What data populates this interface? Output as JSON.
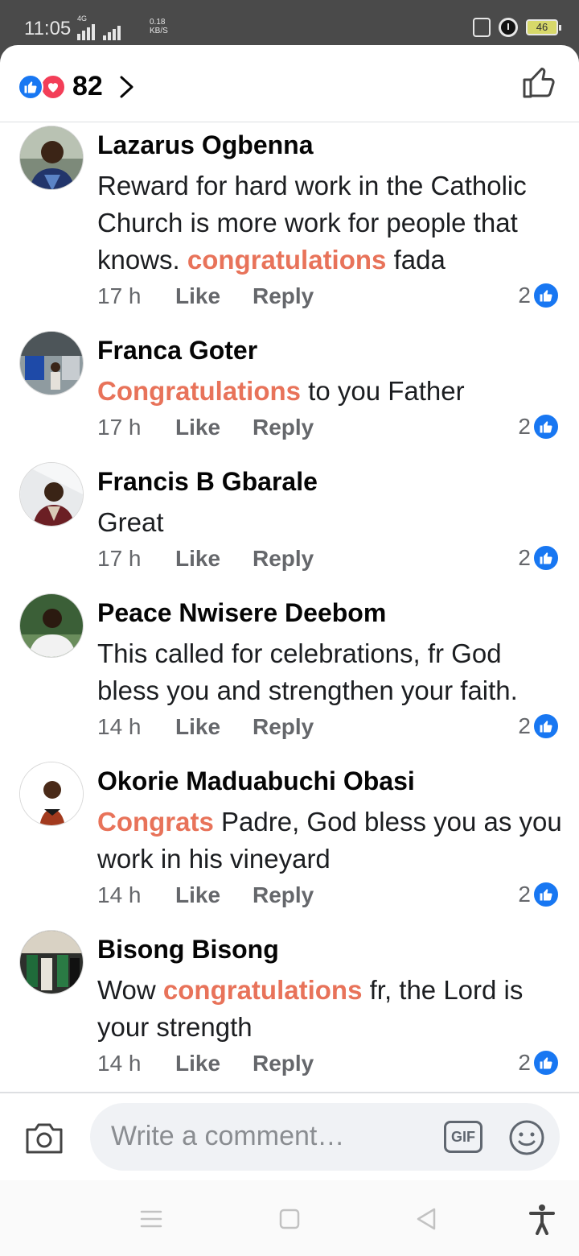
{
  "status_bar": {
    "time": "11:05",
    "network": "4G",
    "speed_value": "0.18",
    "speed_unit": "KB/S",
    "battery": "46"
  },
  "header": {
    "reaction_count": "82"
  },
  "comments": [
    {
      "name": "Lazarus Ogbenna",
      "text_before": "Reward for hard work in the Catholic Church is more work for people that knows. ",
      "highlight": "congratulations",
      "text_after": " fada",
      "time": "17 h",
      "like_label": "Like",
      "reply_label": "Reply",
      "like_count": "2"
    },
    {
      "name": "Franca Goter",
      "text_before": "",
      "highlight": "Congratulations",
      "text_after": " to you Father",
      "time": "17 h",
      "like_label": "Like",
      "reply_label": "Reply",
      "like_count": "2"
    },
    {
      "name": "Francis B Gbarale",
      "text_before": "Great",
      "highlight": "",
      "text_after": "",
      "time": "17 h",
      "like_label": "Like",
      "reply_label": "Reply",
      "like_count": "2"
    },
    {
      "name": "Peace Nwisere Deebom",
      "text_before": "This called for celebrations, fr God bless you and strengthen your faith.",
      "highlight": "",
      "text_after": "",
      "time": "14 h",
      "like_label": "Like",
      "reply_label": "Reply",
      "like_count": "2"
    },
    {
      "name": "Okorie Maduabuchi Obasi",
      "text_before": "",
      "highlight": "Congrats",
      "text_after": " Padre, God bless you as you work in his vineyard",
      "time": "14 h",
      "like_label": "Like",
      "reply_label": "Reply",
      "like_count": "2"
    },
    {
      "name": "Bisong Bisong",
      "text_before": "Wow ",
      "highlight": "congratulations",
      "text_after": " fr, the Lord is your strength",
      "time": "14 h",
      "like_label": "Like",
      "reply_label": "Reply",
      "like_count": "2"
    }
  ],
  "composer": {
    "placeholder": "Write a comment…",
    "gif_label": "GIF"
  },
  "colors": {
    "facebook_blue": "#1877f2",
    "love_red": "#f33e58",
    "highlight": "#e8735a"
  },
  "icons": [
    "like-reaction-icon",
    "love-reaction-icon",
    "chevron-right-icon",
    "thumbs-up-icon",
    "camera-icon",
    "gif-icon",
    "emoji-icon",
    "menu-icon",
    "home-square-icon",
    "back-triangle-icon",
    "accessibility-icon"
  ]
}
